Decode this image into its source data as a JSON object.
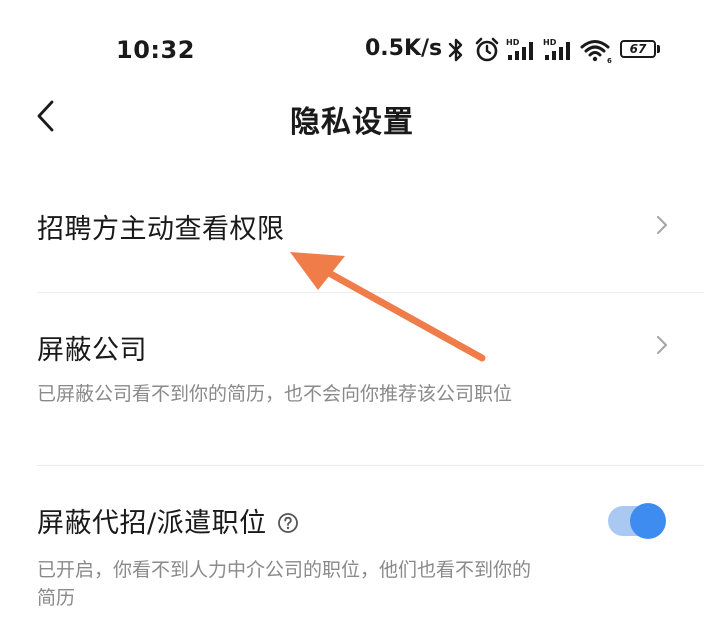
{
  "status_bar": {
    "time": "10:32",
    "network_speed": "0.5K/s",
    "icons": [
      "bluetooth-icon",
      "alarm-icon",
      "hd-signal-icon",
      "hd-signal-icon",
      "wifi-icon",
      "battery-icon"
    ],
    "battery_level": "67"
  },
  "nav": {
    "back_icon": "chevron-left-icon",
    "title": "隐私设置"
  },
  "settings": {
    "items": [
      {
        "title": "招聘方主动查看权限",
        "control": "chevron-right-icon"
      },
      {
        "title": "屏蔽公司",
        "description": "已屏蔽公司看不到你的简历，也不会向你推荐该公司职位",
        "control": "chevron-right-icon"
      },
      {
        "title": "屏蔽代招/派遣职位",
        "help_icon": "question-circle-icon",
        "description": "已开启，你看不到人力中介公司的职位，他们也看不到你的简历",
        "control": "toggle-switch",
        "toggle_on": true
      }
    ]
  },
  "annotation": {
    "type": "arrow",
    "color": "#f07c4a"
  },
  "colors": {
    "accent": "#3f8cf0",
    "toggle_track": "#a9c9f3",
    "secondary_text": "#8a8a8a",
    "divider": "#ececec"
  }
}
